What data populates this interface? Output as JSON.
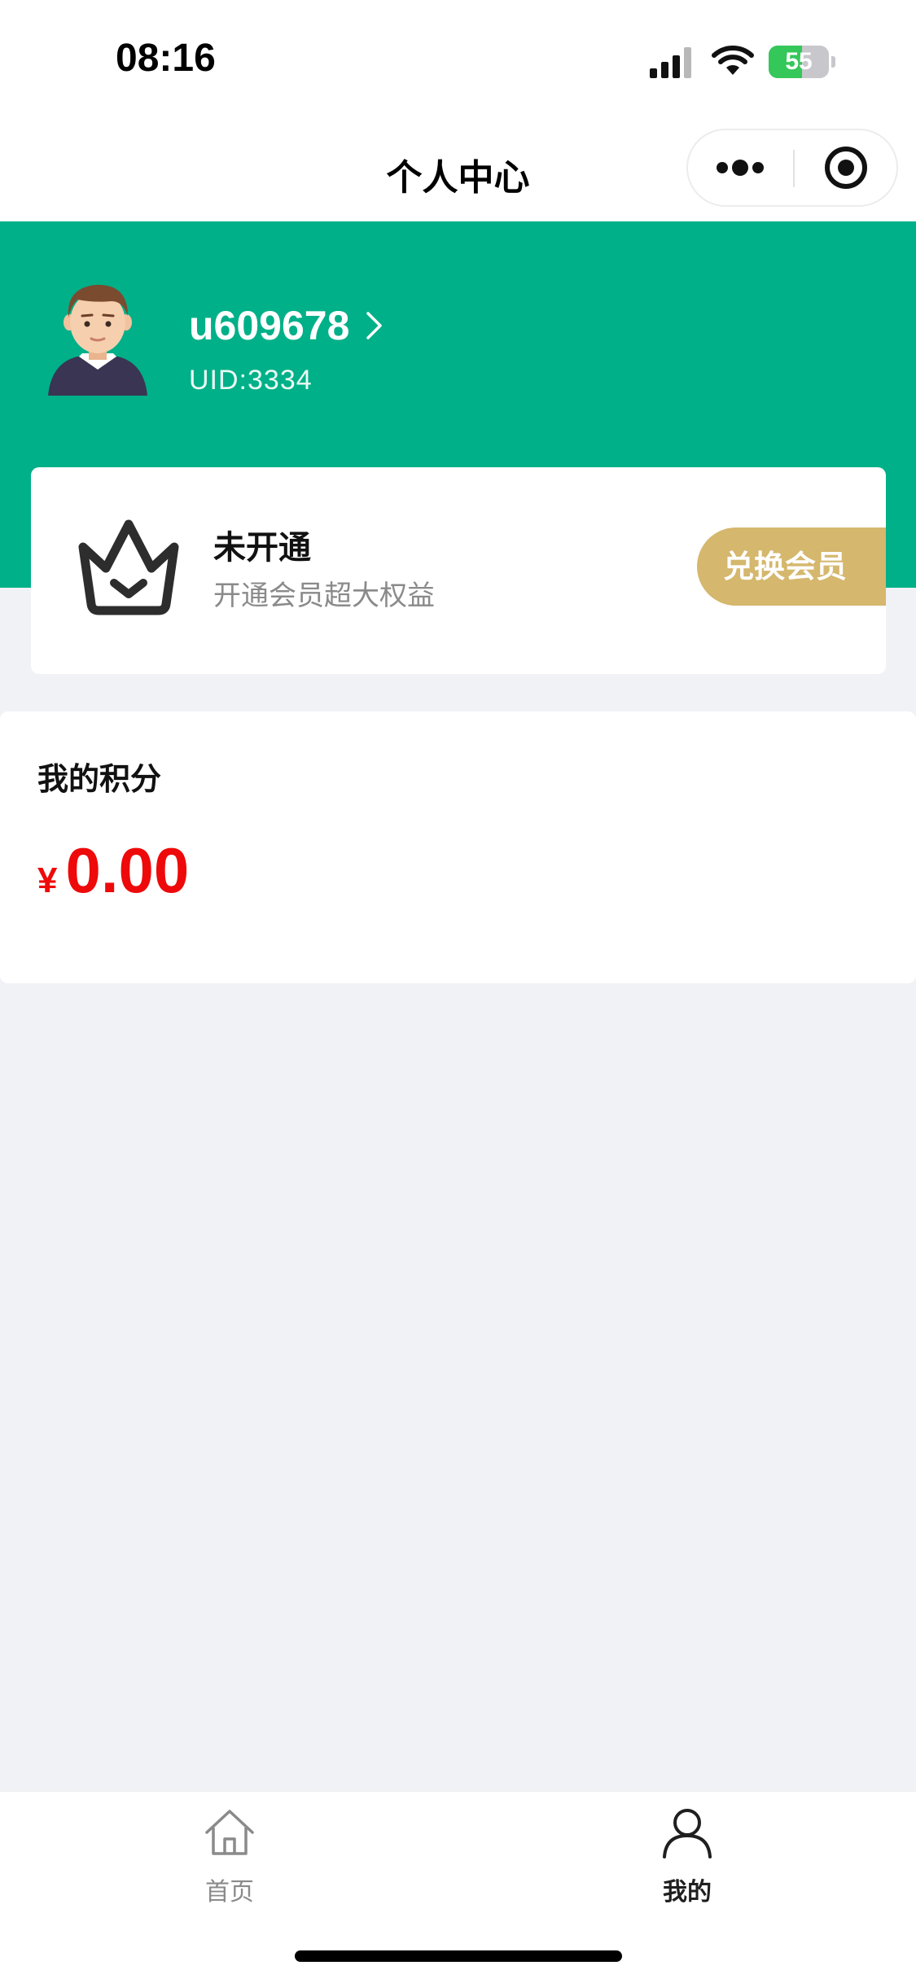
{
  "status_bar": {
    "time": "08:16",
    "battery_level": "55",
    "battery_fraction": 0.55,
    "icons": [
      "signal-icon",
      "wifi-icon",
      "battery-charging-icon"
    ]
  },
  "nav": {
    "title": "个人中心",
    "capsule_icons": [
      "more-dots-icon",
      "close-target-icon"
    ]
  },
  "profile": {
    "username": "u609678",
    "uid": "UID:3334",
    "icons": [
      "avatar",
      "chevron-right-icon"
    ]
  },
  "membership": {
    "status": "未开通",
    "description": "开通会员超大权益",
    "button_label": "兑换会员",
    "icon": "crown-icon"
  },
  "points": {
    "title": "我的积分",
    "currency": "¥",
    "value": "0.00"
  },
  "tab_bar": {
    "items": [
      {
        "label": "首页",
        "icon": "home-icon",
        "active": false
      },
      {
        "label": "我的",
        "icon": "user-icon",
        "active": true
      }
    ]
  },
  "colors": {
    "header_green": "#00b088",
    "gold_button": "#d5b76d",
    "points_red": "#ee0a0a",
    "page_bg": "#f1f2f6"
  }
}
